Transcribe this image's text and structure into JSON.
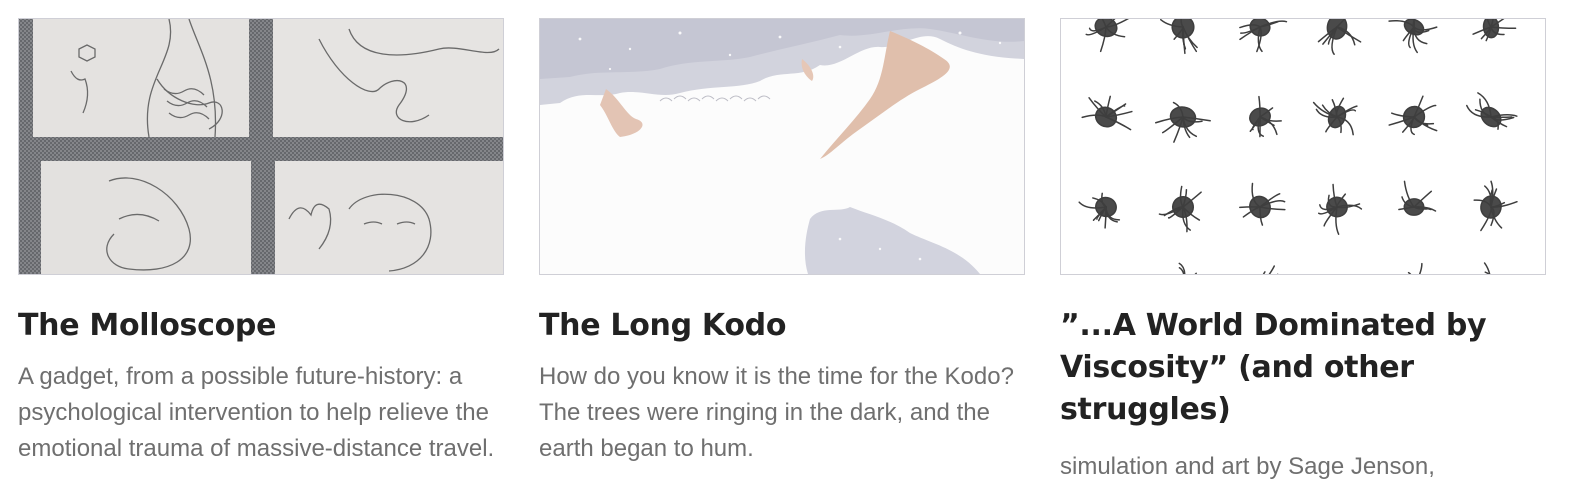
{
  "cards": [
    {
      "title": "The Molloscope",
      "description": "A gadget, from a possible future-history: a psychological intervention to help relieve the emotional trauma of massive-distance travel."
    },
    {
      "title": "The Long Kodo",
      "description": "How do you know it is the time for the Kodo? The trees were ringing in the dark, and the earth began to hum."
    },
    {
      "title": "”...A World Dominated by Viscosity” (and other struggles)",
      "description": "simulation and art by Sage Jenson,"
    }
  ],
  "colors": {
    "title": "#222222",
    "description": "#6f6f6f",
    "thumb_border": "#cfcfd6"
  }
}
